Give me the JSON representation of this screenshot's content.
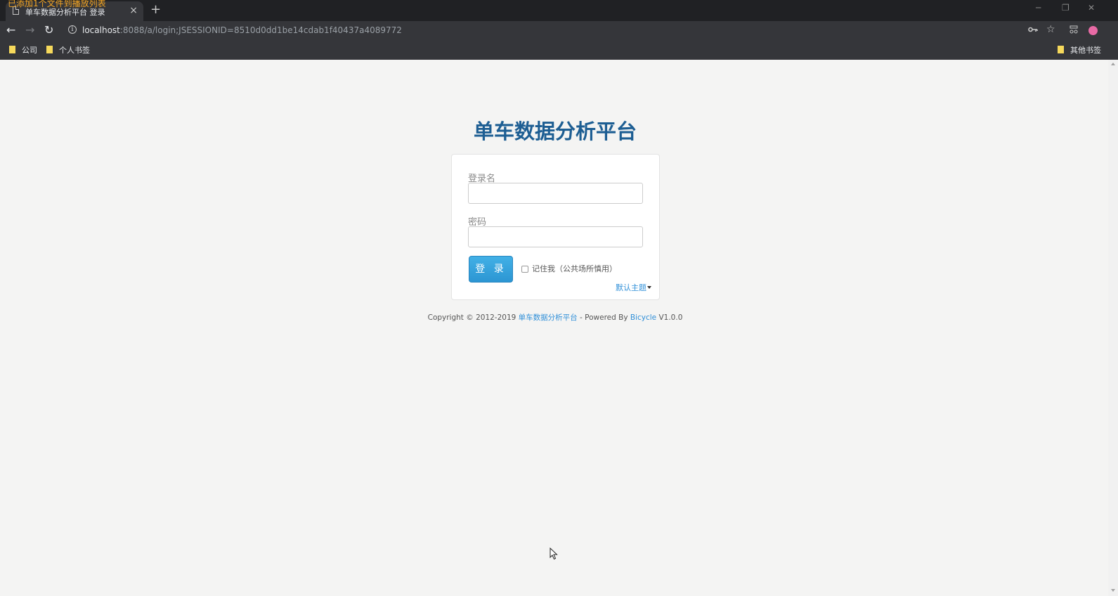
{
  "browser": {
    "overlay_notice": "已添加1个文件到播放列表",
    "tab": {
      "title": "单车数据分析平台 登录",
      "close": "×"
    },
    "new_tab": "+",
    "window_buttons": {
      "minimize": "─",
      "restore": "❐",
      "close": "✕"
    },
    "nav": {
      "back": "←",
      "forward": "→",
      "reload": "↻"
    },
    "url": {
      "host": "localhost",
      "path": ":8088/a/login;JSESSIONID=8510d0dd1be14cdab1f40437a4089772"
    },
    "icons": [
      "info-icon",
      "key-icon",
      "star-icon",
      "extension-icon",
      "profile-avatar"
    ],
    "bookmarks": {
      "left": [
        "公司",
        "个人书签"
      ],
      "right": "其他书签"
    }
  },
  "page": {
    "app_title": "单车数据分析平台",
    "form": {
      "username_label": "登录名",
      "username_value": "",
      "password_label": "密码",
      "password_value": "",
      "login_button": "登 录",
      "remember_me": "记住我（公共场所慎用）",
      "remember_checked": false,
      "theme_link": "默认主题"
    },
    "footer": {
      "prefix": "Copyright © 2012-2019 ",
      "site_link": "单车数据分析平台",
      "middle": " - Powered By ",
      "powered_link": "Bicycle",
      "version": " V1.0.0"
    }
  },
  "colors": {
    "title_blue": "#1d5e93",
    "link_blue": "#2f8fd8",
    "button_blue": "#2c96d3",
    "page_bg": "#f4f4f3"
  }
}
